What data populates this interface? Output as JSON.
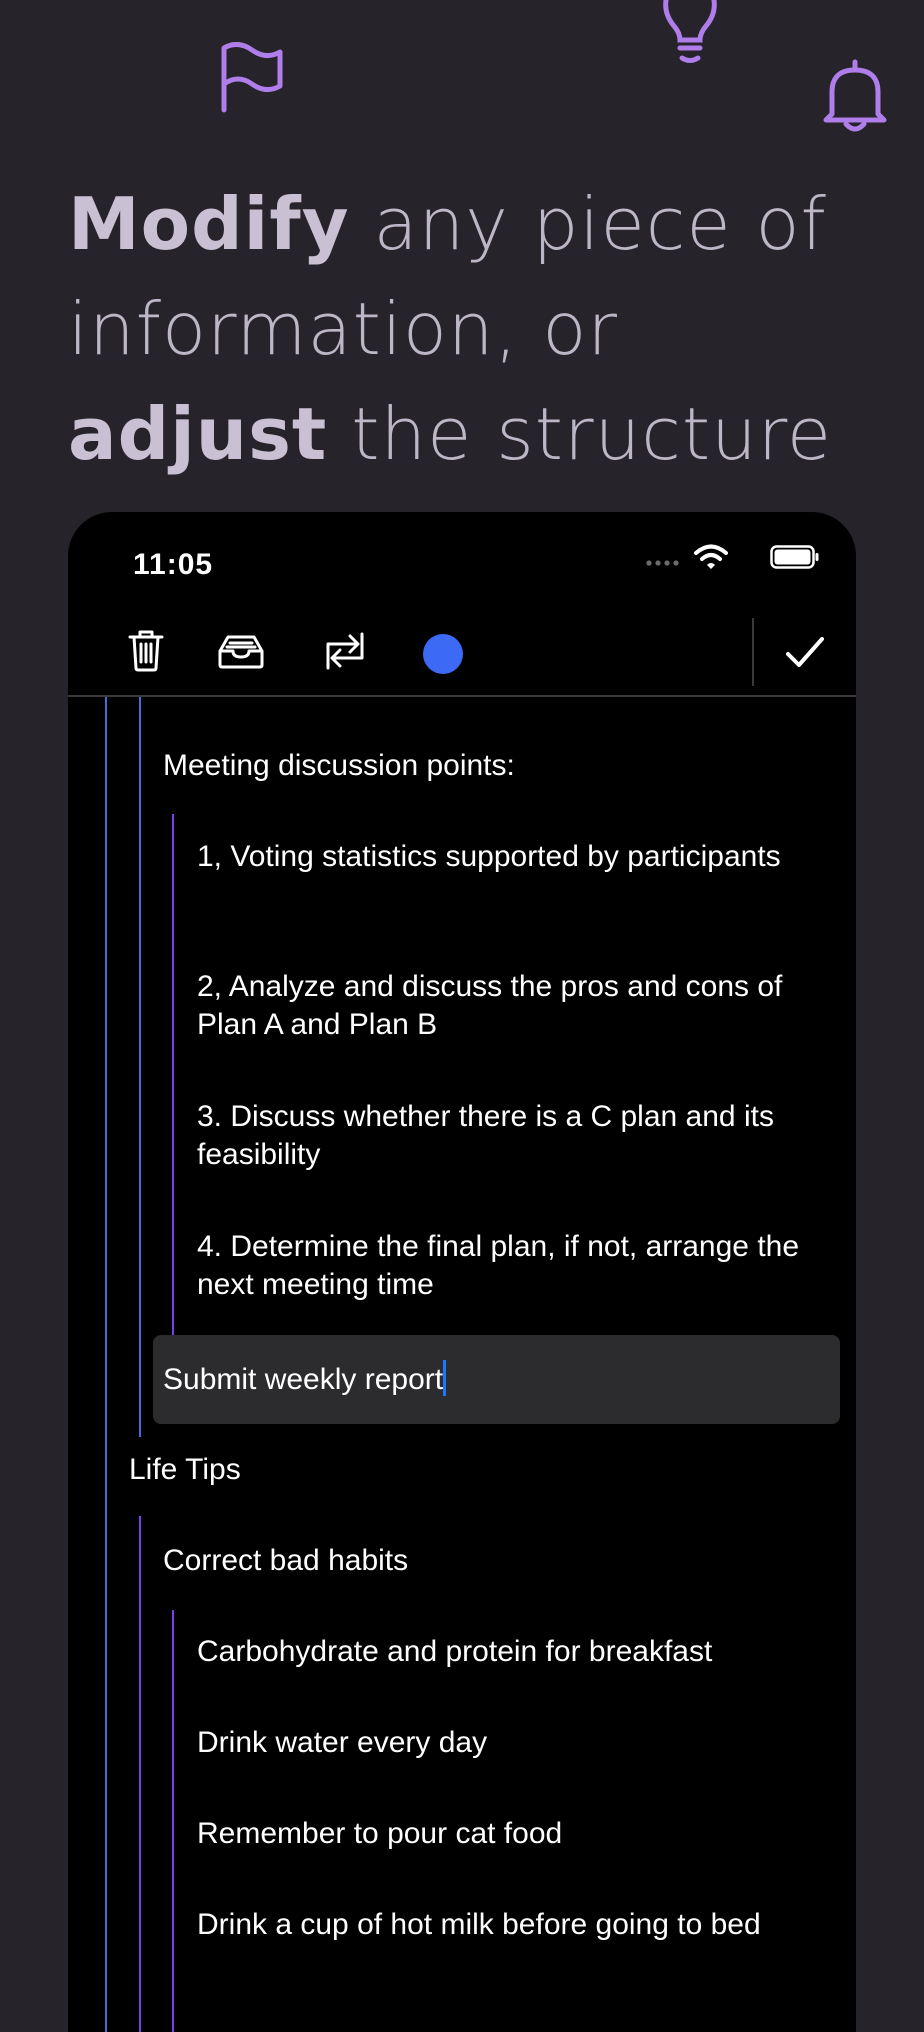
{
  "headline": {
    "bold_1": "Modify",
    "text_1": " any piece of information, or ",
    "bold_2": "adjust",
    "text_2": " the structure"
  },
  "decor_icons": [
    "flag-icon",
    "lightbulb-icon",
    "bell-icon"
  ],
  "phone": {
    "status": {
      "time": "11:05",
      "icons": [
        "signal-dots-icon",
        "wifi-icon",
        "battery-icon"
      ]
    },
    "toolbar": {
      "buttons": [
        "trash-icon",
        "archive-icon",
        "repeat-icon",
        "color-dot",
        "checkmark-icon"
      ],
      "dot_color": "#3d6af5"
    },
    "outline": {
      "meeting_header": "Meeting discussion points:",
      "meeting_items": [
        "1, Voting statistics supported by participants",
        "2, Analyze and discuss the pros and cons of Plan A and Plan B",
        "3. Discuss whether there is a C plan and its feasibility",
        "4. Determine the final plan, if not, arrange the next meeting time"
      ],
      "editing_item": "Submit weekly report",
      "life_tips": "Life Tips",
      "habits_header": "Correct bad habits",
      "habit_items": [
        "Carbohydrate and protein for breakfast",
        "Drink water every day",
        "Remember to pour cat food",
        "Drink a cup of hot milk before going to bed"
      ]
    }
  },
  "colors": {
    "background": "#27232b",
    "accent_purple": "#b07eea",
    "guide_blue": "#3c6ee0",
    "guide_purple": "#7c3ee6",
    "caret_blue": "#1e78ff"
  }
}
